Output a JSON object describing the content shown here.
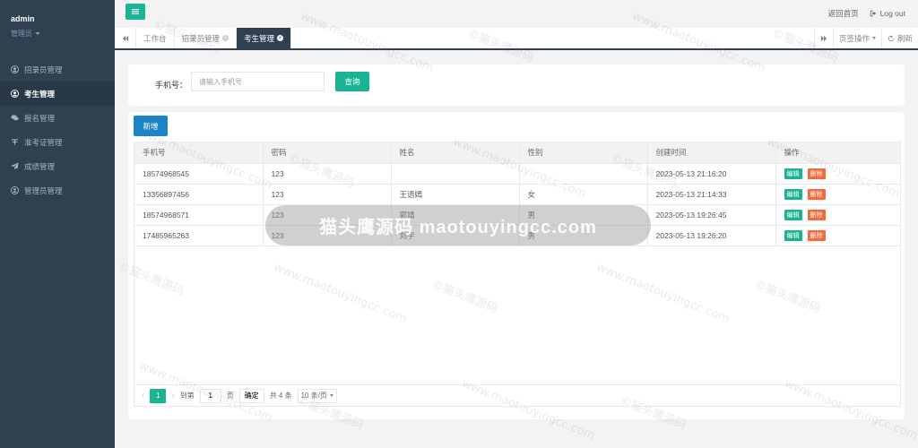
{
  "profile": {
    "username": "admin",
    "role": "管理员"
  },
  "nav": [
    {
      "label": "招录员管理",
      "icon": "user-circle-icon",
      "active": false
    },
    {
      "label": "考生管理",
      "icon": "user-circle-icon",
      "active": true
    },
    {
      "label": "报名管理",
      "icon": "comments-icon",
      "active": false
    },
    {
      "label": "准考证管理",
      "icon": "ticket-icon",
      "active": false
    },
    {
      "label": "成绩管理",
      "icon": "send-icon",
      "active": false
    },
    {
      "label": "管理员管理",
      "icon": "user-icon",
      "active": false
    }
  ],
  "topbar": {
    "home_label": "返回首页",
    "logout_label": "Log out"
  },
  "tabs": [
    {
      "label": "工作台",
      "closable": false,
      "active": false
    },
    {
      "label": "招录员管理",
      "closable": true,
      "active": false
    },
    {
      "label": "考生管理",
      "closable": true,
      "active": true
    }
  ],
  "tab_tools": {
    "page_ops_label": "页签操作",
    "refresh_label": "刷新"
  },
  "search": {
    "label": "手机号：",
    "placeholder": "请输入手机号",
    "button_label": "查询"
  },
  "table": {
    "add_label": "新增",
    "columns": [
      "手机号",
      "密码",
      "姓名",
      "性别",
      "创建时间",
      "操作"
    ],
    "rows": [
      {
        "phone": "18574968545",
        "password": "123",
        "name": "",
        "sex": "",
        "created": "2023-05-13 21:16:20"
      },
      {
        "phone": "13356897456",
        "password": "123",
        "name": "王语嫣",
        "sex": "女",
        "created": "2023-05-13 21:14:33"
      },
      {
        "phone": "18574968571",
        "password": "123",
        "name": "郭靖",
        "sex": "男",
        "created": "2023-05-13 19:26:45"
      },
      {
        "phone": "17485965263",
        "password": "123",
        "name": "刘宇",
        "sex": "男",
        "created": "2023-05-13 19:26:20"
      }
    ],
    "edit_label": "编辑",
    "delete_label": "删除"
  },
  "pager": {
    "current_page": "1",
    "goto_prefix": "到第",
    "goto_value": "1",
    "goto_suffix": "页",
    "confirm_label": "确定",
    "total_label": "共 4 条",
    "page_size_label": "10 条/页"
  },
  "watermark": {
    "text_cn": "©猫头鹰源码",
    "text_url": "www.maotouyingcc.com",
    "banner": "猫头鹰源码 maotouyingcc.com"
  },
  "colors": {
    "sidebar": "#2f4050",
    "accent": "#1ab394",
    "primary": "#1c84c6",
    "danger": "#f8693a"
  }
}
